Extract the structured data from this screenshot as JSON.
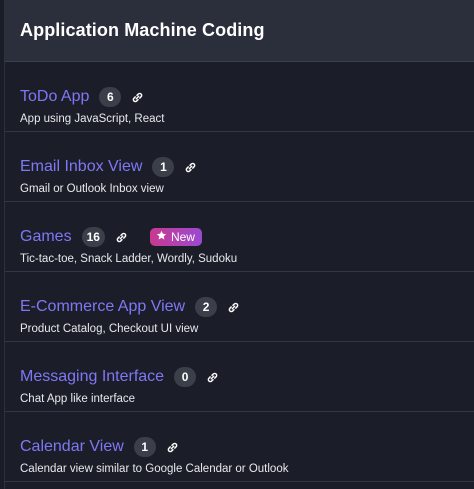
{
  "header": {
    "title": "Application Machine Coding"
  },
  "items": [
    {
      "title": "ToDo App",
      "count": "6",
      "subtitle": "App using JavaScript, React",
      "badge": ""
    },
    {
      "title": "Email Inbox View",
      "count": "1",
      "subtitle": "Gmail or Outlook Inbox view",
      "badge": ""
    },
    {
      "title": "Games",
      "count": "16",
      "subtitle": "Tic-tac-toe, Snack Ladder, Wordly, Sudoku",
      "badge": "New"
    },
    {
      "title": "E-Commerce App View",
      "count": "2",
      "subtitle": "Product Catalog, Checkout UI view",
      "badge": ""
    },
    {
      "title": "Messaging Interface",
      "count": "0",
      "subtitle": "Chat App like interface",
      "badge": ""
    },
    {
      "title": "Calendar View",
      "count": "1",
      "subtitle": "Calendar view similar to Google Calendar or Outlook",
      "badge": ""
    }
  ],
  "colors": {
    "title_link": "#7f77f5",
    "badge_gradient_start": "#c83a8f",
    "badge_gradient_end": "#9a4ad2",
    "count_bg": "#3b3f4a"
  },
  "icons": {
    "link": "link-icon",
    "badge_star": "star-icon"
  }
}
